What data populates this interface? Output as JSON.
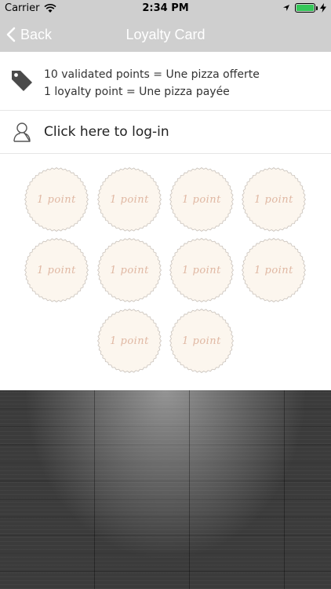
{
  "status_bar": {
    "carrier": "Carrier",
    "time": "2:34 PM"
  },
  "nav": {
    "back_label": "Back",
    "title": "Loyalty Card"
  },
  "info": {
    "line1": "10 validated points = Une pizza offerte",
    "line2": "1 loyalty point = Une pizza payée",
    "icon": "tag-icon"
  },
  "login": {
    "label": "Click here to log-in",
    "icon": "user-icon"
  },
  "stamps": {
    "labels": [
      "1 point",
      "1 point",
      "1 point",
      "1 point",
      "1 point",
      "1 point",
      "1 point",
      "1 point",
      "1 point",
      "1 point"
    ]
  },
  "colors": {
    "nav_bg": "#cfcfcf",
    "stamp_fill": "#fcf6ee",
    "stamp_text": "#e0b8a3",
    "battery": "#35c759"
  }
}
